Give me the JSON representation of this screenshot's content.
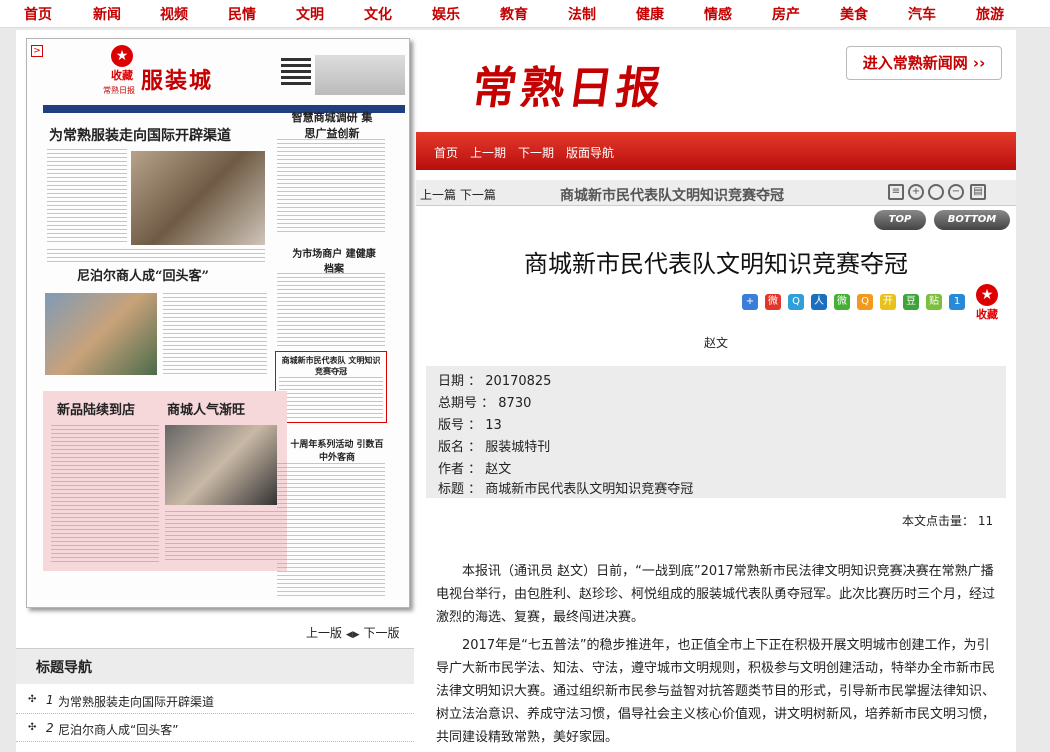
{
  "topnav": [
    "首页",
    "新闻",
    "视频",
    "民情",
    "文明",
    "文化",
    "娱乐",
    "教育",
    "法制",
    "健康",
    "情感",
    "房产",
    "美食",
    "汽车",
    "旅游"
  ],
  "masthead": "常熟日报",
  "enter_link": "进入常熟新闻网 ››",
  "redbar": {
    "items": [
      "首页",
      "上一期",
      "下一期",
      "版面导航"
    ]
  },
  "paper": {
    "fav": "收藏",
    "title": "服装城",
    "sub": "常熟日报",
    "headlines": [
      "为常熟服装走向国际开辟渠道",
      "尼泊尔商人成“回头客”",
      "新品陆续到店",
      "商城人气渐旺",
      "智慧商城调研 集思广益创新",
      "为市场商户 建健康档案",
      "商城新市民代表队 文明知识竞赛夺冠",
      "十周年系列活动 引数百中外客商"
    ]
  },
  "pager_left": {
    "prev": "上一版",
    "next": "下一版"
  },
  "headline_nav": {
    "title": "标题导航",
    "items": [
      {
        "num": "1",
        "text": "为常熟服装走向国际开辟渠道"
      },
      {
        "num": "2",
        "text": "尼泊尔商人成“回头客”"
      }
    ]
  },
  "article_bar": {
    "prev": "上一篇",
    "next": "下一篇",
    "title": "商城新市民代表队文明知识竞赛夺冠"
  },
  "pills": {
    "top": "TOP",
    "bottom": "BOTTOM"
  },
  "article": {
    "title": "商城新市民代表队文明知识竞赛夺冠",
    "fav": "收藏",
    "author": "赵文",
    "meta": [
      {
        "label": "日期",
        "value": "20170825"
      },
      {
        "label": "总期号",
        "value": "8730"
      },
      {
        "label": "版号",
        "value": "13"
      },
      {
        "label": "版名",
        "value": "服装城特刊"
      },
      {
        "label": "作者",
        "value": "赵文"
      },
      {
        "label": "标题",
        "value": "商城新市民代表队文明知识竞赛夺冠"
      }
    ],
    "hits_label": "本文点击量：",
    "hits": "11",
    "paragraphs": [
      "本报讯（通讯员 赵文）日前，“一战到底”2017常熟新市民法律文明知识竞赛决赛在常熟广播电视台举行，由包胜利、赵珍珍、柯悦组成的服装城代表队勇夺冠军。此次比赛历时三个月，经过激烈的海选、复赛，最终闯进决赛。",
      "2017年是“七五普法”的稳步推进年，也正值全市上下正在积极开展文明城市创建工作，为引导广大新市民学法、知法、守法，遵守城市文明规则，积极参与文明创建活动，特举办全市新市民法律文明知识大赛。通过组织新市民参与益智对抗答题类节目的形式，引导新市民掌握法律知识、树立法治意识、养成守法习惯，倡导社会主义核心价值观，讲文明树新风，培养新市民文明习惯，共同建设精致常熟，美好家园。"
    ]
  },
  "icons": [
    "search-zoom-in-icon",
    "zoom-out-icon",
    "print-icon",
    "note-icon",
    "share-icons",
    "star-icon",
    "arrow-left-icon",
    "arrow-right-icon"
  ]
}
